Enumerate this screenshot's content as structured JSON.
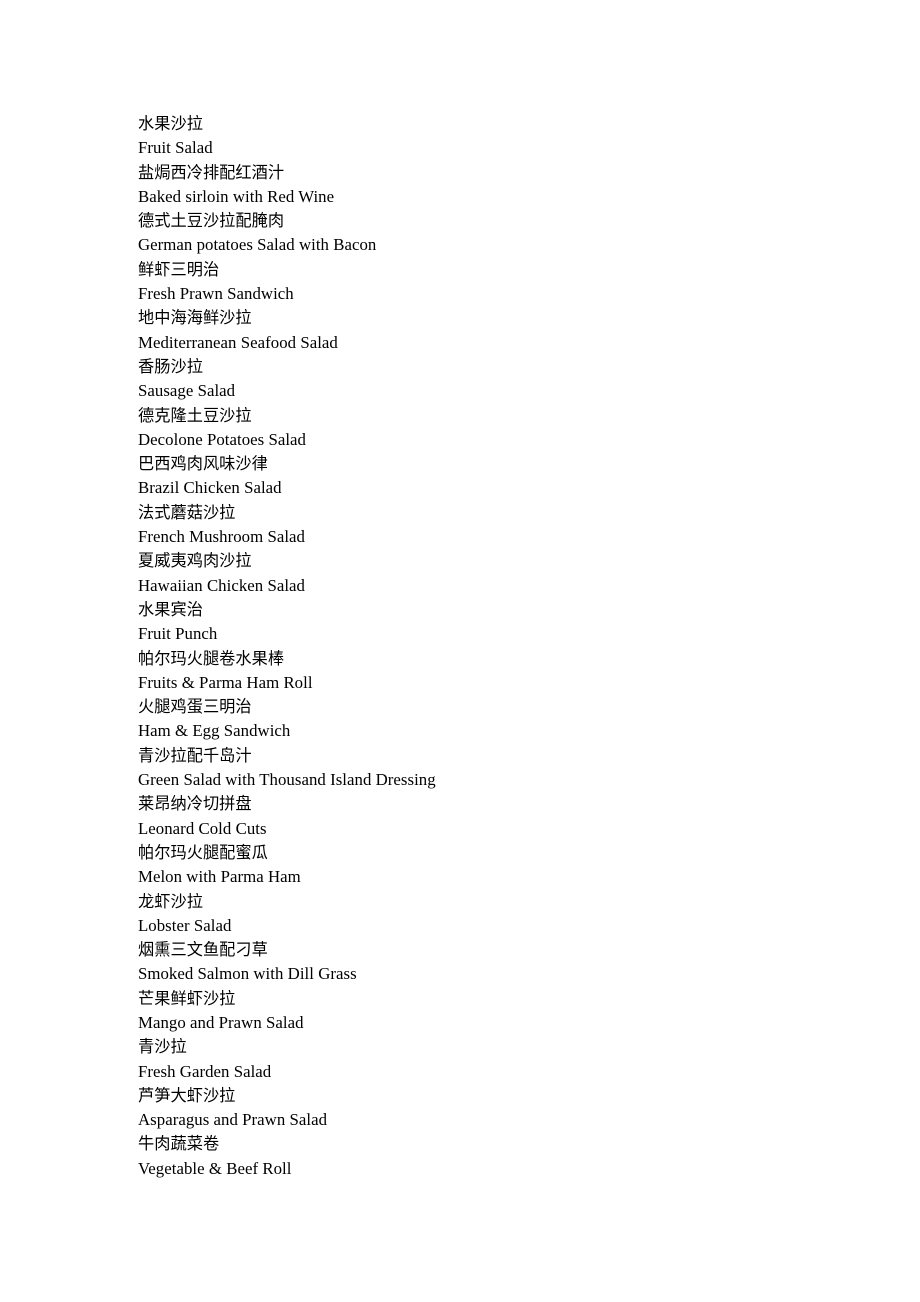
{
  "document": {
    "type": "menu-item-list",
    "background_color": "#ffffff",
    "text_color": "#000000",
    "items": [
      {
        "zh": "水果沙拉",
        "en": "Fruit Salad"
      },
      {
        "zh": "盐焗西冷排配红酒汁",
        "en": "Baked sirloin with Red Wine"
      },
      {
        "zh": "德式土豆沙拉配腌肉",
        "en": "German potatoes Salad with Bacon"
      },
      {
        "zh": "鲜虾三明治",
        "en": "Fresh Prawn Sandwich"
      },
      {
        "zh": "地中海海鲜沙拉",
        "en": "Mediterranean Seafood Salad"
      },
      {
        "zh": "香肠沙拉",
        "en": "Sausage Salad"
      },
      {
        "zh": "德克隆土豆沙拉",
        "en": "Decolone Potatoes Salad"
      },
      {
        "zh": "巴西鸡肉风味沙律",
        "en": "Brazil Chicken Salad"
      },
      {
        "zh": "法式蘑菇沙拉",
        "en": "French Mushroom Salad"
      },
      {
        "zh": "夏威夷鸡肉沙拉",
        "en": "Hawaiian Chicken Salad"
      },
      {
        "zh": "水果宾治",
        "en": "Fruit Punch"
      },
      {
        "zh": "帕尔玛火腿卷水果棒",
        "en": "Fruits & Parma Ham Roll"
      },
      {
        "zh": "火腿鸡蛋三明治",
        "en": "Ham & Egg Sandwich"
      },
      {
        "zh": "青沙拉配千岛汁",
        "en": "Green Salad with Thousand Island Dressing"
      },
      {
        "zh": "莱昂纳冷切拼盘",
        "en": "Leonard Cold Cuts"
      },
      {
        "zh": "帕尔玛火腿配蜜瓜",
        "en": "Melon with Parma Ham"
      },
      {
        "zh": "龙虾沙拉",
        "en": "Lobster Salad"
      },
      {
        "zh": "烟熏三文鱼配刁草",
        "en": "Smoked Salmon with Dill Grass"
      },
      {
        "zh": "芒果鲜虾沙拉",
        "en": "Mango and Prawn Salad"
      },
      {
        "zh": "青沙拉",
        "en": "Fresh Garden Salad"
      },
      {
        "zh": "芦笋大虾沙拉",
        "en": "Asparagus and Prawn Salad"
      },
      {
        "zh": "牛肉蔬菜卷",
        "en": "Vegetable & Beef Roll"
      }
    ]
  }
}
